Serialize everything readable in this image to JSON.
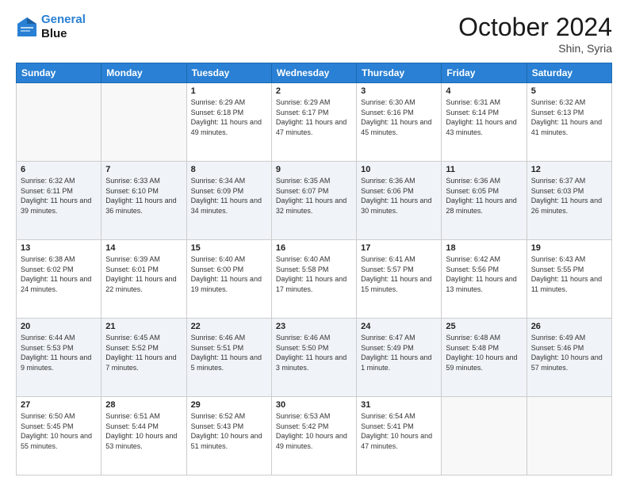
{
  "header": {
    "logo_line1": "General",
    "logo_line2": "Blue",
    "month": "October 2024",
    "location": "Shin, Syria"
  },
  "weekdays": [
    "Sunday",
    "Monday",
    "Tuesday",
    "Wednesday",
    "Thursday",
    "Friday",
    "Saturday"
  ],
  "weeks": [
    [
      {
        "day": "",
        "content": ""
      },
      {
        "day": "",
        "content": ""
      },
      {
        "day": "1",
        "content": "Sunrise: 6:29 AM\nSunset: 6:18 PM\nDaylight: 11 hours and 49 minutes."
      },
      {
        "day": "2",
        "content": "Sunrise: 6:29 AM\nSunset: 6:17 PM\nDaylight: 11 hours and 47 minutes."
      },
      {
        "day": "3",
        "content": "Sunrise: 6:30 AM\nSunset: 6:16 PM\nDaylight: 11 hours and 45 minutes."
      },
      {
        "day": "4",
        "content": "Sunrise: 6:31 AM\nSunset: 6:14 PM\nDaylight: 11 hours and 43 minutes."
      },
      {
        "day": "5",
        "content": "Sunrise: 6:32 AM\nSunset: 6:13 PM\nDaylight: 11 hours and 41 minutes."
      }
    ],
    [
      {
        "day": "6",
        "content": "Sunrise: 6:32 AM\nSunset: 6:11 PM\nDaylight: 11 hours and 39 minutes."
      },
      {
        "day": "7",
        "content": "Sunrise: 6:33 AM\nSunset: 6:10 PM\nDaylight: 11 hours and 36 minutes."
      },
      {
        "day": "8",
        "content": "Sunrise: 6:34 AM\nSunset: 6:09 PM\nDaylight: 11 hours and 34 minutes."
      },
      {
        "day": "9",
        "content": "Sunrise: 6:35 AM\nSunset: 6:07 PM\nDaylight: 11 hours and 32 minutes."
      },
      {
        "day": "10",
        "content": "Sunrise: 6:36 AM\nSunset: 6:06 PM\nDaylight: 11 hours and 30 minutes."
      },
      {
        "day": "11",
        "content": "Sunrise: 6:36 AM\nSunset: 6:05 PM\nDaylight: 11 hours and 28 minutes."
      },
      {
        "day": "12",
        "content": "Sunrise: 6:37 AM\nSunset: 6:03 PM\nDaylight: 11 hours and 26 minutes."
      }
    ],
    [
      {
        "day": "13",
        "content": "Sunrise: 6:38 AM\nSunset: 6:02 PM\nDaylight: 11 hours and 24 minutes."
      },
      {
        "day": "14",
        "content": "Sunrise: 6:39 AM\nSunset: 6:01 PM\nDaylight: 11 hours and 22 minutes."
      },
      {
        "day": "15",
        "content": "Sunrise: 6:40 AM\nSunset: 6:00 PM\nDaylight: 11 hours and 19 minutes."
      },
      {
        "day": "16",
        "content": "Sunrise: 6:40 AM\nSunset: 5:58 PM\nDaylight: 11 hours and 17 minutes."
      },
      {
        "day": "17",
        "content": "Sunrise: 6:41 AM\nSunset: 5:57 PM\nDaylight: 11 hours and 15 minutes."
      },
      {
        "day": "18",
        "content": "Sunrise: 6:42 AM\nSunset: 5:56 PM\nDaylight: 11 hours and 13 minutes."
      },
      {
        "day": "19",
        "content": "Sunrise: 6:43 AM\nSunset: 5:55 PM\nDaylight: 11 hours and 11 minutes."
      }
    ],
    [
      {
        "day": "20",
        "content": "Sunrise: 6:44 AM\nSunset: 5:53 PM\nDaylight: 11 hours and 9 minutes."
      },
      {
        "day": "21",
        "content": "Sunrise: 6:45 AM\nSunset: 5:52 PM\nDaylight: 11 hours and 7 minutes."
      },
      {
        "day": "22",
        "content": "Sunrise: 6:46 AM\nSunset: 5:51 PM\nDaylight: 11 hours and 5 minutes."
      },
      {
        "day": "23",
        "content": "Sunrise: 6:46 AM\nSunset: 5:50 PM\nDaylight: 11 hours and 3 minutes."
      },
      {
        "day": "24",
        "content": "Sunrise: 6:47 AM\nSunset: 5:49 PM\nDaylight: 11 hours and 1 minute."
      },
      {
        "day": "25",
        "content": "Sunrise: 6:48 AM\nSunset: 5:48 PM\nDaylight: 10 hours and 59 minutes."
      },
      {
        "day": "26",
        "content": "Sunrise: 6:49 AM\nSunset: 5:46 PM\nDaylight: 10 hours and 57 minutes."
      }
    ],
    [
      {
        "day": "27",
        "content": "Sunrise: 6:50 AM\nSunset: 5:45 PM\nDaylight: 10 hours and 55 minutes."
      },
      {
        "day": "28",
        "content": "Sunrise: 6:51 AM\nSunset: 5:44 PM\nDaylight: 10 hours and 53 minutes."
      },
      {
        "day": "29",
        "content": "Sunrise: 6:52 AM\nSunset: 5:43 PM\nDaylight: 10 hours and 51 minutes."
      },
      {
        "day": "30",
        "content": "Sunrise: 6:53 AM\nSunset: 5:42 PM\nDaylight: 10 hours and 49 minutes."
      },
      {
        "day": "31",
        "content": "Sunrise: 6:54 AM\nSunset: 5:41 PM\nDaylight: 10 hours and 47 minutes."
      },
      {
        "day": "",
        "content": ""
      },
      {
        "day": "",
        "content": ""
      }
    ]
  ]
}
